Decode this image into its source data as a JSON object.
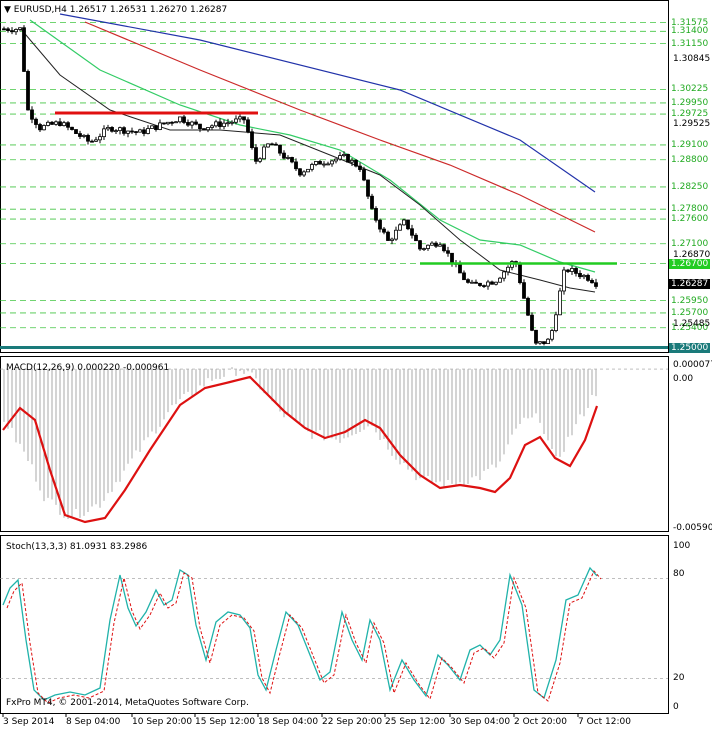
{
  "header": {
    "symbol_line": "EURUSD,H4  1.26517 1.26531 1.26270 1.26287"
  },
  "macd": {
    "label": "MACD(12,26,9) 0.000220 -0.000961",
    "axis_labels": [
      "0.000077",
      "0.00",
      "-0.005906"
    ]
  },
  "stoch": {
    "label": "Stoch(13,3,3) 81.0931 83.2986",
    "axis_labels": [
      "100",
      "80",
      "20",
      "0"
    ]
  },
  "footer": {
    "copyright": "FxPro MT4, © 2001-2014, MetaQuotes Software Corp."
  },
  "price_axis": {
    "plain_labels": [
      "1.30845",
      "1.29525",
      "1.26870",
      "1.25485"
    ],
    "boxed_labels": [
      {
        "text": "1.31575",
        "bg": "#ffffff",
        "fg": "#22aa22"
      },
      {
        "text": "1.31400",
        "bg": "#ffffff",
        "fg": "#22aa22"
      },
      {
        "text": "1.31150",
        "bg": "#ffffff",
        "fg": "#22aa22"
      },
      {
        "text": "1.30225",
        "bg": "#ffffff",
        "fg": "#22aa22"
      },
      {
        "text": "1.29950",
        "bg": "#ffffff",
        "fg": "#22aa22"
      },
      {
        "text": "1.29725",
        "bg": "#ffffff",
        "fg": "#22aa22"
      },
      {
        "text": "1.29100",
        "bg": "#ffffff",
        "fg": "#22aa22"
      },
      {
        "text": "1.28800",
        "bg": "#ffffff",
        "fg": "#22aa22"
      },
      {
        "text": "1.28250",
        "bg": "#ffffff",
        "fg": "#22aa22"
      },
      {
        "text": "1.27800",
        "bg": "#ffffff",
        "fg": "#22aa22"
      },
      {
        "text": "1.27600",
        "bg": "#ffffff",
        "fg": "#22aa22"
      },
      {
        "text": "1.27100",
        "bg": "#ffffff",
        "fg": "#22aa22"
      },
      {
        "text": "1.26700",
        "bg": "#22cc22",
        "fg": "#ffffff"
      },
      {
        "text": "1.26287",
        "bg": "#000000",
        "fg": "#ffffff"
      },
      {
        "text": "1.25950",
        "bg": "#ffffff",
        "fg": "#22aa22"
      },
      {
        "text": "1.25700",
        "bg": "#ffffff",
        "fg": "#22aa22"
      },
      {
        "text": "1.25400",
        "bg": "#ffffff",
        "fg": "#22aa22"
      },
      {
        "text": "1.25000",
        "bg": "#1a7a7a",
        "fg": "#ffffff"
      }
    ]
  },
  "time_axis": [
    "3 Sep 2014",
    "8 Sep 04:00",
    "10 Sep 20:00",
    "15 Sep 12:00",
    "18 Sep 04:00",
    "22 Sep 20:00",
    "25 Sep 12:00",
    "30 Sep 04:00",
    "2 Oct 20:00",
    "7 Oct 12:00"
  ],
  "colors": {
    "ma_blue": "#2233aa",
    "ma_red": "#cc2a2a",
    "ma_green": "#33cc66",
    "ma_black": "#222222",
    "support_teal": "#1a7a7a",
    "resistance_red": "#e01010",
    "neckline_green": "#22cc22",
    "macd_signal": "#dd1111",
    "macd_hist": "#aaaaaa",
    "stoch_main": "#20b2aa",
    "stoch_signal": "#dd1111",
    "grid_green": "#22bb22"
  },
  "chart_data": [
    {
      "type": "line",
      "title": "EURUSD,H4",
      "notes": "candlestick price chart with moving averages and horizontal levels",
      "x": [
        "3 Sep 2014",
        "8 Sep 04:00",
        "10 Sep 20:00",
        "15 Sep 12:00",
        "18 Sep 04:00",
        "22 Sep 20:00",
        "25 Sep 12:00",
        "30 Sep 04:00",
        "2 Oct 20:00",
        "7 Oct 12:00"
      ],
      "ylim": [
        1.2495,
        1.3175
      ],
      "series": [
        {
          "name": "close",
          "values": [
            1.3145,
            1.2955,
            1.2945,
            1.2965,
            1.2875,
            1.286,
            1.2765,
            1.26,
            1.251,
            1.2629
          ]
        }
      ],
      "levels": [
        1.31575,
        1.314,
        1.3115,
        1.30225,
        1.2995,
        1.29725,
        1.291,
        1.288,
        1.2825,
        1.278,
        1.276,
        1.271,
        1.267,
        1.2595,
        1.257,
        1.254,
        1.25
      ]
    },
    {
      "type": "line",
      "title": "MACD(12,26,9)",
      "ylim": [
        -0.005906,
        7.7e-05
      ],
      "series": [
        {
          "name": "signal",
          "values": [
            -0.002,
            -0.005,
            -0.004,
            -0.0015,
            0.0,
            -0.002,
            -0.003,
            -0.0045,
            -0.0042,
            -0.0009
          ]
        }
      ]
    },
    {
      "type": "line",
      "title": "Stoch(13,3,3)",
      "ylim": [
        0,
        100
      ],
      "series": [
        {
          "name": "main",
          "values": [
            80,
            10,
            82,
            55,
            35,
            60,
            40,
            30,
            5,
            81
          ]
        },
        {
          "name": "signal",
          "values": [
            75,
            12,
            78,
            58,
            38,
            55,
            42,
            28,
            8,
            83
          ]
        }
      ]
    }
  ]
}
